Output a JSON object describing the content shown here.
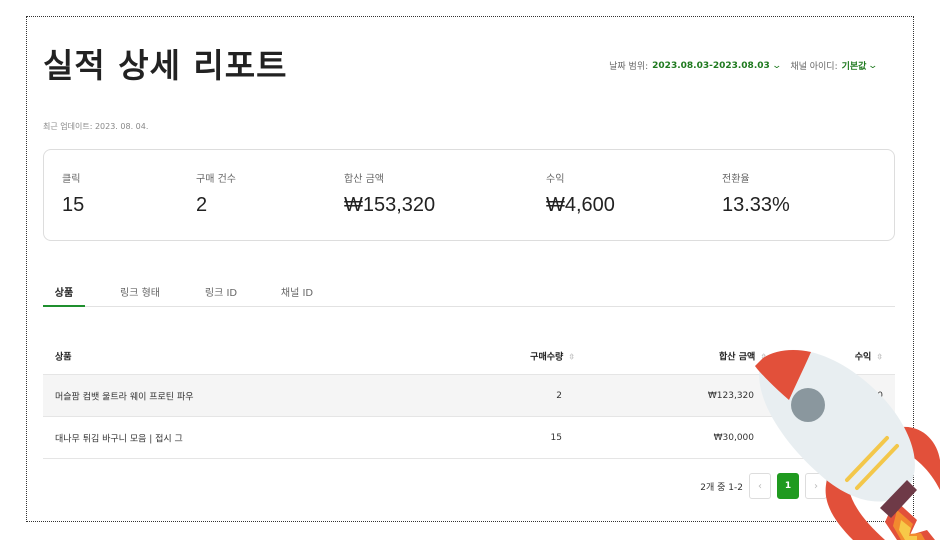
{
  "header": {
    "title": "실적 상세 리포트",
    "date_range_label": "날짜 범위:",
    "date_range_value": "2023.08.03-2023.08.03",
    "channel_label": "채널 아이디:",
    "channel_value": "기본값"
  },
  "updated": "최근 업데이트: 2023. 08. 04.",
  "stats": [
    {
      "label": "클릭",
      "value": "15"
    },
    {
      "label": "구매 건수",
      "value": "2"
    },
    {
      "label": "합산 금액",
      "value": "₩153,320"
    },
    {
      "label": "수익",
      "value": "₩4,600"
    },
    {
      "label": "전환율",
      "value": "13.33%"
    }
  ],
  "tabs": [
    {
      "label": "상품",
      "active": true
    },
    {
      "label": "링크 형태",
      "active": false
    },
    {
      "label": "링크 ID",
      "active": false
    },
    {
      "label": "채널 ID",
      "active": false
    }
  ],
  "table": {
    "columns": [
      "상품",
      "구매수량",
      "합산 금액",
      "수익"
    ],
    "rows": [
      {
        "name": "머슬팜 컴뱃 울트라 웨이 프로틴 파우",
        "qty": "2",
        "amount": "₩123,320",
        "revenue": "₩3,700"
      },
      {
        "name": "대나무 튀김 바구니 모음 | 접시 그",
        "qty": "15",
        "amount": "₩30,000",
        "revenue": ""
      }
    ]
  },
  "pagination": {
    "summary": "2개 중 1-2",
    "prev_icon": "chevron-left-icon",
    "next_icon": "chevron-right-icon",
    "current_page": "1"
  },
  "colors": {
    "accent_green": "#1f9a1f",
    "rocket_red": "#e2503a",
    "rocket_body": "#e8eef1"
  }
}
